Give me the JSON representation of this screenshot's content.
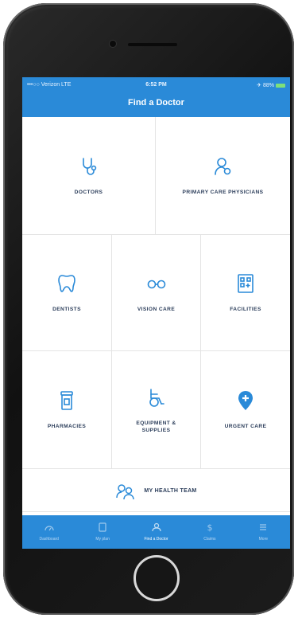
{
  "status_bar": {
    "carrier": "•••○○ Verizon LTE",
    "time": "6:52 PM",
    "battery": "✈ 88%"
  },
  "nav": {
    "title": "Find a Doctor"
  },
  "tiles": [
    {
      "label": "DOCTORS",
      "icon": "stethoscope-icon"
    },
    {
      "label": "PRIMARY CARE PHYSICIANS",
      "icon": "physician-icon"
    },
    {
      "label": "DENTISTS",
      "icon": "tooth-icon"
    },
    {
      "label": "VISION CARE",
      "icon": "glasses-icon"
    },
    {
      "label": "FACILITIES",
      "icon": "building-icon"
    },
    {
      "label": "PHARMACIES",
      "icon": "pill-bottle-icon"
    },
    {
      "label_line1": "EQUIPMENT &",
      "label_line2": "SUPPLIES",
      "icon": "wheelchair-icon"
    },
    {
      "label": "URGENT CARE",
      "icon": "location-pin-icon"
    }
  ],
  "team": {
    "label": "MY HEALTH TEAM",
    "icon": "team-icon"
  },
  "tabs": [
    {
      "label": "Dashboard",
      "icon": "gauge-icon"
    },
    {
      "label": "My plan",
      "icon": "card-icon"
    },
    {
      "label": "Find a Doctor",
      "icon": "doctor-icon",
      "active": true
    },
    {
      "label": "Claims",
      "icon": "dollar-icon"
    },
    {
      "label": "More",
      "icon": "menu-icon"
    }
  ],
  "colors": {
    "brand_blue": "#2a8ad8",
    "label_navy": "#2b3d5a",
    "icon_blue": "#2a8ad8"
  }
}
